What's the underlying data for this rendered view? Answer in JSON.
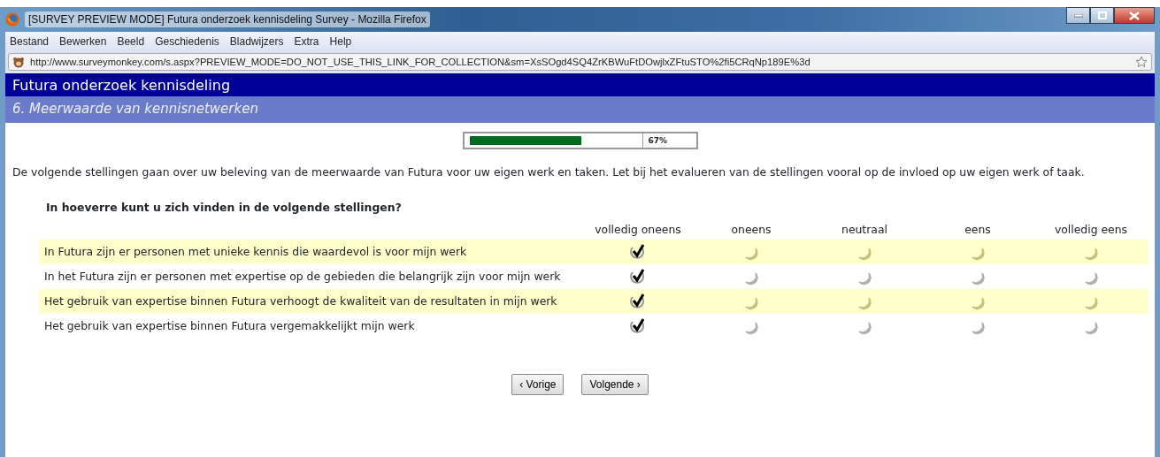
{
  "window": {
    "title": "[SURVEY PREVIEW MODE] Futura onderzoek kennisdeling Survey - Mozilla Firefox"
  },
  "menu": [
    "Bestand",
    "Bewerken",
    "Beeld",
    "Geschiedenis",
    "Bladwijzers",
    "Extra",
    "Help"
  ],
  "address_bar": {
    "value": "http://www.surveymonkey.com/s.aspx?PREVIEW_MODE=DO_NOT_USE_THIS_LINK_FOR_COLLECTION&sm=XsSOgd4SQ4ZrKBWuFtDOwjlxZFtuSTO%2fi5CRqNp189E%3d"
  },
  "survey": {
    "title": "Futura onderzoek kennisdeling",
    "page_title": "6. Meerwaarde van kennisnetwerken",
    "progress": {
      "level": 0.67,
      "reading": "67%"
    },
    "intro": "De volgende stellingen gaan over uw beleving van de meerwaarde van Futura voor uw eigen werk en taken. Let bij het evalueren van de stellingen vooral op de invloed op uw eigen werk of taak.",
    "question": "In hoeverre kunt u zich vinden in de volgende stellingen?",
    "columns": [
      "volledig oneens",
      "oneens",
      "neutraal",
      "eens",
      "volledig eens"
    ],
    "rows": [
      {
        "statement": "In Futura zijn er personen met unieke kennis die waardevol is voor mijn werk",
        "shaded": true,
        "answers": [
          {
            "selected": true
          },
          {
            "selected": false
          },
          {
            "selected": false
          },
          {
            "selected": false
          },
          {
            "selected": false
          }
        ]
      },
      {
        "statement": "In het Futura zijn er personen met expertise op de gebieden die belangrijk zijn voor mijn werk",
        "shaded": false,
        "answers": [
          {
            "selected": true
          },
          {
            "selected": false
          },
          {
            "selected": false
          },
          {
            "selected": false
          },
          {
            "selected": false
          }
        ]
      },
      {
        "statement": "Het gebruik van expertise binnen Futura verhoogt de kwaliteit van de resultaten in mijn werk",
        "shaded": true,
        "answers": [
          {
            "selected": true
          },
          {
            "selected": false
          },
          {
            "selected": false
          },
          {
            "selected": false
          },
          {
            "selected": false
          }
        ]
      },
      {
        "statement": "Het gebruik van expertise binnen Futura vergemakkelijkt mijn werk",
        "shaded": false,
        "answers": [
          {
            "selected": true
          },
          {
            "selected": false
          },
          {
            "selected": false
          },
          {
            "selected": false
          },
          {
            "selected": false
          }
        ]
      }
    ],
    "buttons": [
      "‹ Vorige",
      "Volgende ›"
    ]
  }
}
